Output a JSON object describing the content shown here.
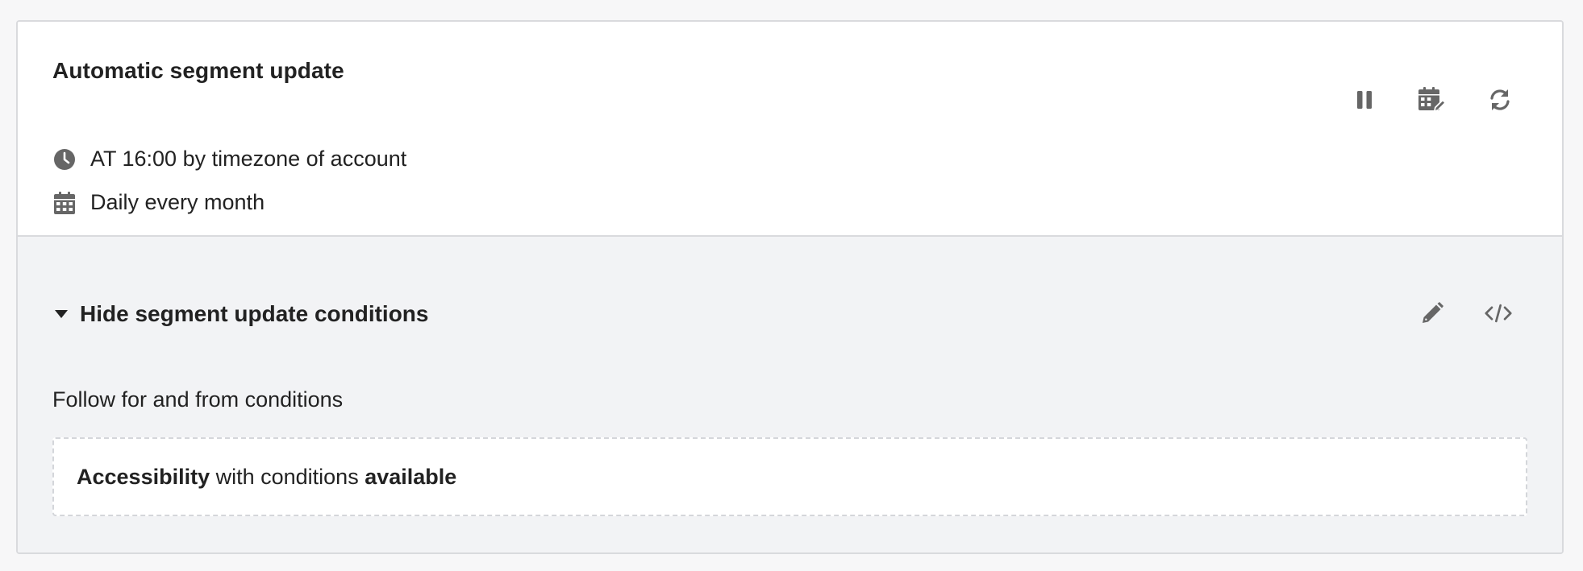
{
  "card": {
    "title": "Automatic segment update",
    "schedule_time": "AT 16:00 by timezone of account",
    "schedule_frequency": "Daily every month",
    "icons": {
      "time": "clock-icon",
      "frequency": "calendar-icon",
      "pause": "pause-icon",
      "edit_schedule": "calendar-edit-icon",
      "refresh": "refresh-icon"
    }
  },
  "conditions": {
    "toggle_label": "Hide segment update conditions",
    "follow_label": "Follow for and from conditions",
    "rule": {
      "field": "Accessibility",
      "connector": " with conditions ",
      "value": "available"
    },
    "icons": {
      "toggle": "caret-down-icon",
      "edit": "pencil-icon",
      "code": "code-icon"
    }
  },
  "colors": {
    "icon": "#666666",
    "text": "#222222",
    "bottom_background": "#f2f3f5"
  }
}
